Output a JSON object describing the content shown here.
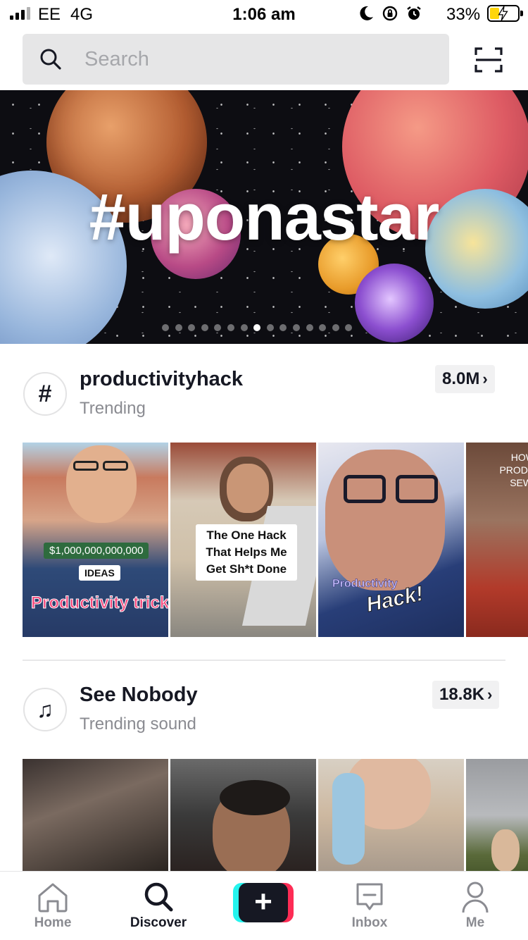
{
  "status_bar": {
    "carrier": "EE",
    "network": "4G",
    "time": "1:06 am",
    "battery_percent": "33%",
    "battery_level": 0.33,
    "icons": [
      "moon-icon",
      "rotation-lock-icon",
      "alarm-icon",
      "battery-charging-icon"
    ]
  },
  "search": {
    "placeholder": "Search",
    "scan_icon": "scan-icon"
  },
  "banner": {
    "title": "#uponastar",
    "page_count": 15,
    "active_page": 8
  },
  "sections": [
    {
      "icon": "hashtag-icon",
      "icon_glyph": "#",
      "title": "productivityhack",
      "subtitle": "Trending",
      "count": "8.0M",
      "thumbnails": [
        {
          "labels": [
            "$1,000,000,000,000",
            "IDEAS",
            "Productivity trick"
          ]
        },
        {
          "labels": [
            "The One Hack That Helps Me Get Sh*t Done"
          ]
        },
        {
          "labels": [
            "Productivity",
            "Hack!"
          ]
        },
        {
          "labels": [
            "HOW PRODU SEWI"
          ]
        }
      ]
    },
    {
      "icon": "music-note-icon",
      "icon_glyph": "♫",
      "title": "See Nobody",
      "subtitle": "Trending sound",
      "count": "18.8K",
      "thumbnails": [
        {},
        {},
        {},
        {}
      ]
    }
  ],
  "nav": {
    "items": [
      {
        "label": "Home",
        "icon": "home-icon"
      },
      {
        "label": "Discover",
        "icon": "search-icon",
        "active": true
      },
      {
        "label": "",
        "icon": "plus-icon"
      },
      {
        "label": "Inbox",
        "icon": "inbox-icon"
      },
      {
        "label": "Me",
        "icon": "person-icon"
      }
    ]
  },
  "colors": {
    "accent_red": "#fe2c55",
    "accent_cyan": "#25f4ee",
    "text_primary": "#161823",
    "text_secondary": "#8a8b91"
  }
}
